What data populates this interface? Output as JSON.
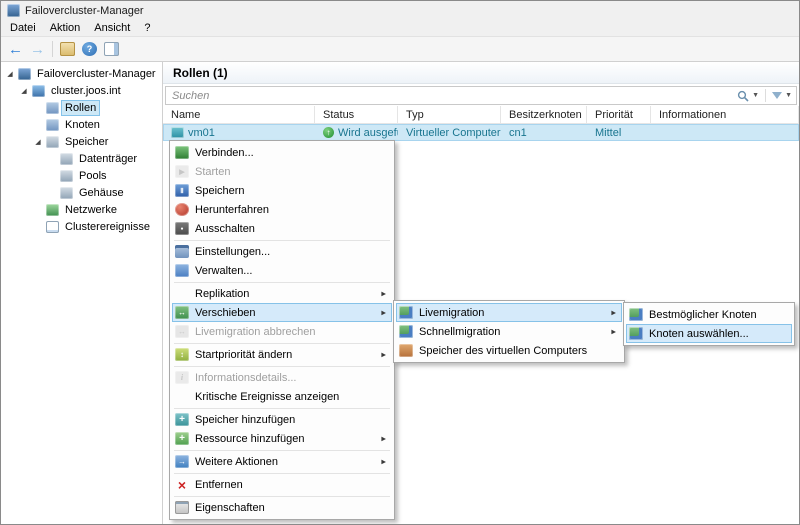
{
  "window": {
    "title": "Failovercluster-Manager"
  },
  "menubar": {
    "items": [
      "Datei",
      "Aktion",
      "Ansicht",
      "?"
    ]
  },
  "tree": {
    "items": [
      {
        "label": "Failovercluster-Manager"
      },
      {
        "label": "cluster.joos.int"
      },
      {
        "label": "Rollen"
      },
      {
        "label": "Knoten"
      },
      {
        "label": "Speicher"
      },
      {
        "label": "Datenträger"
      },
      {
        "label": "Pools"
      },
      {
        "label": "Gehäuse"
      },
      {
        "label": "Netzwerke"
      },
      {
        "label": "Clusterereignisse"
      }
    ]
  },
  "main": {
    "header": "Rollen (1)",
    "search": {
      "placeholder": "Suchen"
    },
    "table": {
      "columns": [
        "Name",
        "Status",
        "Typ",
        "Besitzerknoten",
        "Priorität",
        "Informationen"
      ],
      "row": {
        "name": "vm01",
        "status": "Wird ausgeführt",
        "typ": "Virtueller Computer",
        "besitzerknoten": "cn1",
        "prioritaet": "Mittel",
        "informationen": ""
      }
    }
  },
  "context_menu": {
    "items": [
      {
        "label": "Verbinden..."
      },
      {
        "label": "Starten",
        "disabled": true
      },
      {
        "label": "Speichern"
      },
      {
        "label": "Herunterfahren"
      },
      {
        "label": "Ausschalten"
      },
      {
        "label": "Einstellungen..."
      },
      {
        "label": "Verwalten..."
      },
      {
        "label": "Replikation",
        "submenu": true
      },
      {
        "label": "Verschieben",
        "submenu": true,
        "highlighted": true
      },
      {
        "label": "Livemigration abbrechen",
        "disabled": true
      },
      {
        "label": "Startpriorität ändern",
        "submenu": true
      },
      {
        "label": "Informationsdetails...",
        "disabled": true
      },
      {
        "label": "Kritische Ereignisse anzeigen"
      },
      {
        "label": "Speicher hinzufügen"
      },
      {
        "label": "Ressource hinzufügen",
        "submenu": true
      },
      {
        "label": "Weitere Aktionen",
        "submenu": true
      },
      {
        "label": "Entfernen"
      },
      {
        "label": "Eigenschaften"
      }
    ]
  },
  "submenu_verschieben": {
    "items": [
      {
        "label": "Livemigration",
        "submenu": true,
        "highlighted": true
      },
      {
        "label": "Schnellmigration",
        "submenu": true
      },
      {
        "label": "Speicher des virtuellen Computers"
      }
    ]
  },
  "submenu_livemigration": {
    "items": [
      {
        "label": "Bestmöglicher Knoten"
      },
      {
        "label": "Knoten auswählen...",
        "highlighted": true
      }
    ]
  },
  "colors": {
    "selection": "#cde8f6",
    "selection_border": "#84c3ea",
    "status_text": "#19758f",
    "accent": "#2f7fd6"
  }
}
